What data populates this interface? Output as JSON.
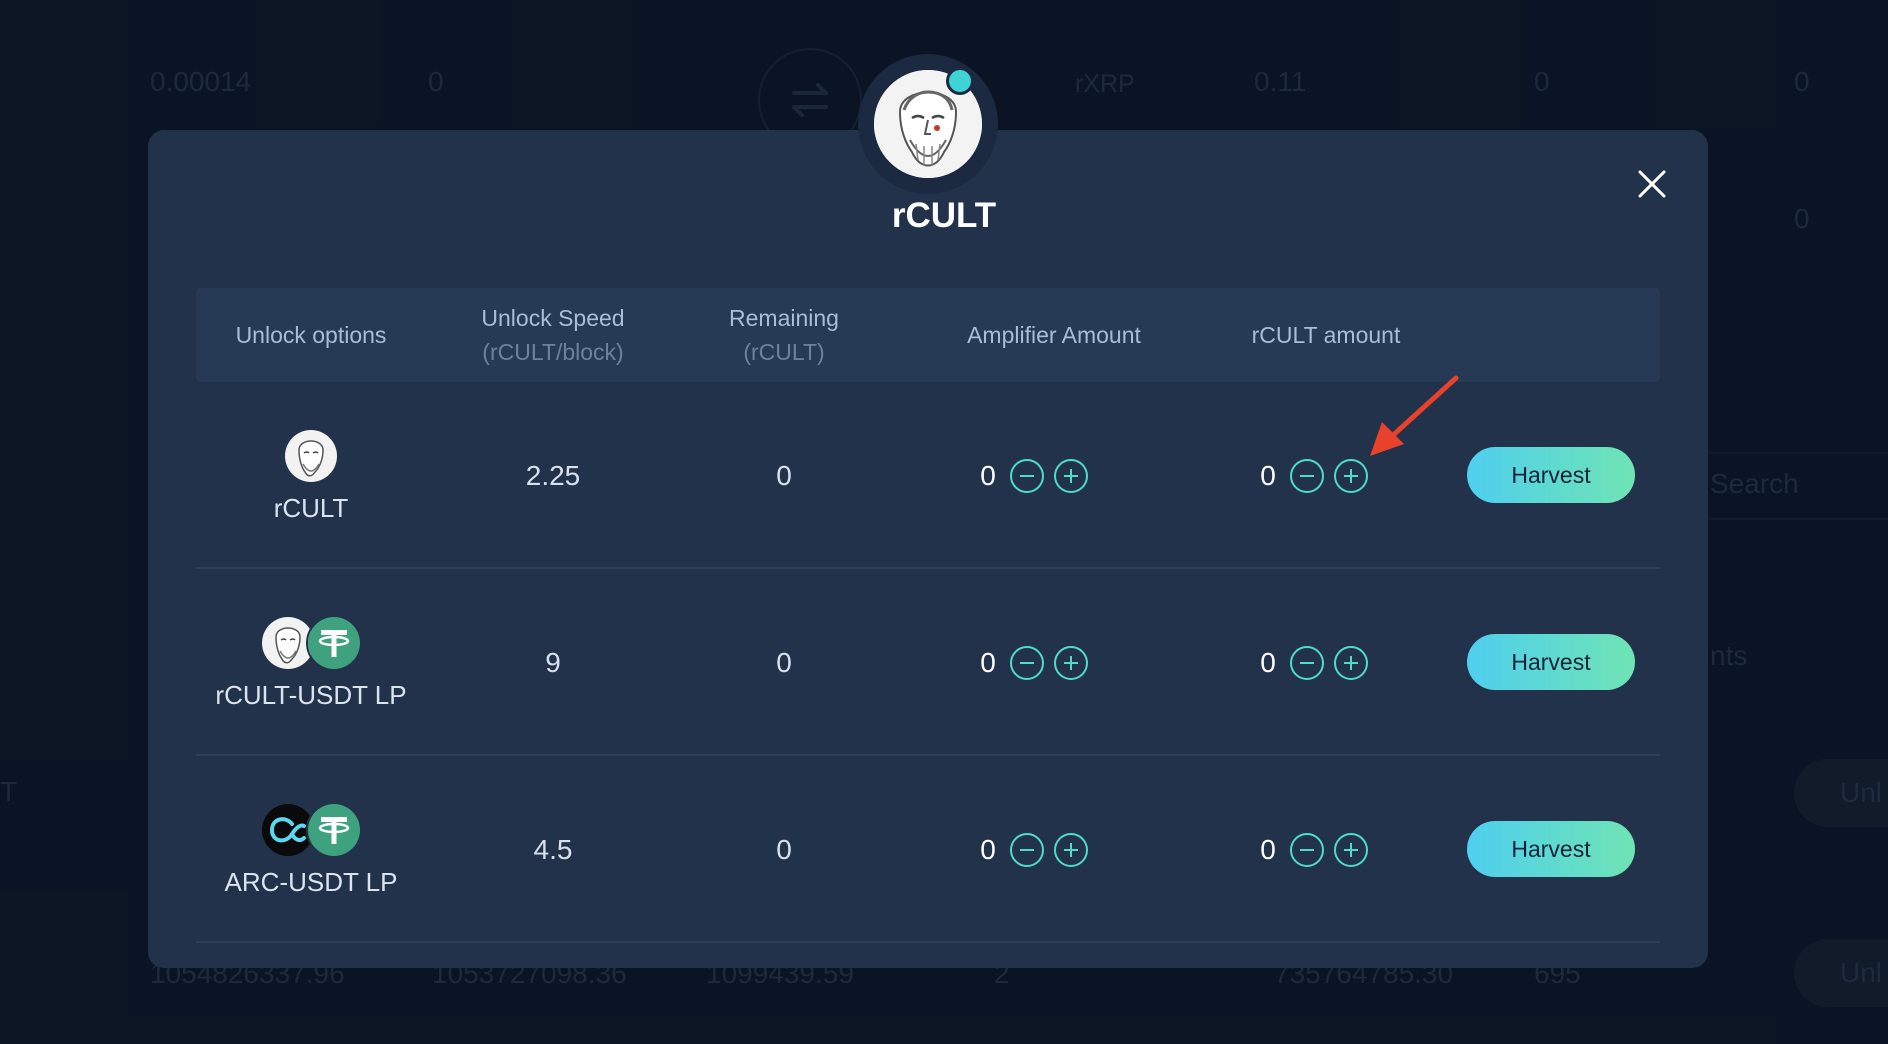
{
  "background": {
    "top_row": [
      "0.00014",
      "0",
      "rXRP",
      "0.11",
      "0",
      "0"
    ],
    "right_value_2": "0",
    "search_placeholder": "Search",
    "partial_label": "nts",
    "partial_left": "T",
    "unlock_label": "Unl",
    "bottom_row": [
      "1054826337.96",
      "1053727098.36",
      "1099439.59",
      "2",
      "735764785.30",
      "695"
    ]
  },
  "modal": {
    "title": "rCULT",
    "columns": [
      {
        "label": "Unlock options",
        "sub": ""
      },
      {
        "label": "Unlock Speed",
        "sub": "(rCULT/block)"
      },
      {
        "label": "Remaining",
        "sub": "(rCULT)"
      },
      {
        "label": "Amplifier Amount",
        "sub": ""
      },
      {
        "label": "rCULT amount",
        "sub": ""
      }
    ],
    "rows": [
      {
        "name": "rCULT",
        "speed": "2.25",
        "remaining": "0",
        "amplifier": "0",
        "rcult_amount": "0",
        "action": "Harvest"
      },
      {
        "name": "rCULT-USDT LP",
        "speed": "9",
        "remaining": "0",
        "amplifier": "0",
        "rcult_amount": "0",
        "action": "Harvest"
      },
      {
        "name": "ARC-USDT LP",
        "speed": "4.5",
        "remaining": "0",
        "amplifier": "0",
        "rcult_amount": "0",
        "action": "Harvest"
      }
    ]
  },
  "colors": {
    "accent": "#4fdcc7",
    "harvest_gradient_start": "#4ecfef",
    "harvest_gradient_end": "#6fe4b4",
    "annotation_arrow": "#e8412c"
  }
}
